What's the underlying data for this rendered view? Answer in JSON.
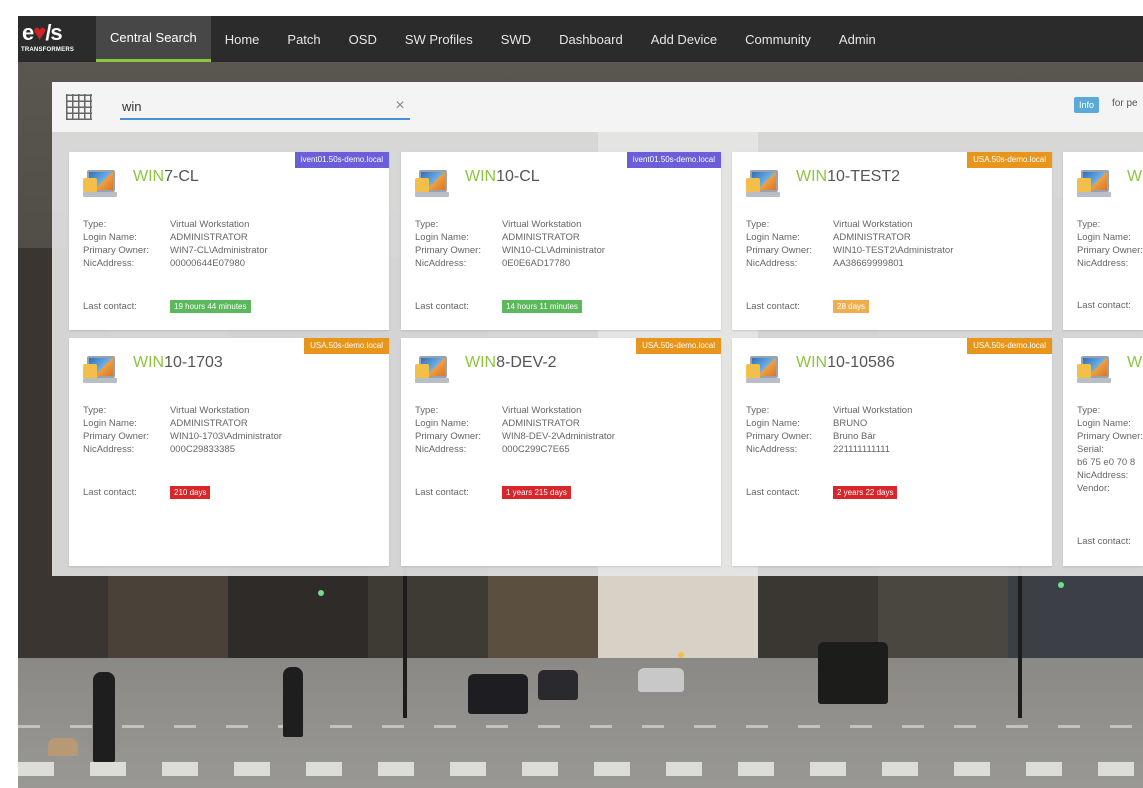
{
  "brand": {
    "logo_text": "e",
    "logo_heart": "♥",
    "logo_suffix": "/s",
    "logo_subtitle": "TRANSFORMERS"
  },
  "nav": {
    "items": [
      {
        "label": "Central Search",
        "active": true
      },
      {
        "label": "Home"
      },
      {
        "label": "Patch"
      },
      {
        "label": "OSD"
      },
      {
        "label": "SW Profiles"
      },
      {
        "label": "SWD"
      },
      {
        "label": "Dashboard"
      },
      {
        "label": "Add Device"
      },
      {
        "label": "Community"
      },
      {
        "label": "Admin"
      }
    ]
  },
  "search": {
    "value": "win",
    "clear_icon": "×",
    "info_badge": "Info",
    "info_text": "for pe"
  },
  "labels": {
    "type": "Type:",
    "login_name": "Login Name:",
    "primary_owner": "Primary Owner:",
    "nic_address": "NicAddress:",
    "serial": "Serial:",
    "vendor": "Vendor:",
    "last_contact": "Last contact:"
  },
  "cards": [
    {
      "name_hl": "WIN",
      "name_rest": "7-CL",
      "domain": "ivent01.50s-demo.local",
      "domain_color": "purple",
      "type": "Virtual Workstation",
      "login_name": "ADMINISTRATOR",
      "primary_owner": "WIN7-CL\\Administrator",
      "nic_address": "00000644E07980",
      "last_contact": "19 hours 44 minutes",
      "contact_color": "green"
    },
    {
      "name_hl": "WIN",
      "name_rest": "10-CL",
      "domain": "ivent01.50s-demo.local",
      "domain_color": "purple",
      "type": "Virtual Workstation",
      "login_name": "ADMINISTRATOR",
      "primary_owner": "WIN10-CL\\Administrator",
      "nic_address": "0E0E6AD17780",
      "last_contact": "14 hours 11 minutes",
      "contact_color": "green"
    },
    {
      "name_hl": "WIN",
      "name_rest": "10-TEST2",
      "domain": "USA.50s-demo.local",
      "domain_color": "orange",
      "type": "Virtual Workstation",
      "login_name": "ADMINISTRATOR",
      "primary_owner": "WIN10-TEST2\\Administrator",
      "nic_address": "AA38669999801",
      "last_contact": "28 days",
      "contact_color": "orange"
    },
    {
      "name_hl": "WI",
      "name_rest": "",
      "domain": "",
      "domain_color": "purple",
      "type_label_only": true,
      "last_contact_label_only": true
    },
    {
      "name_hl": "WIN",
      "name_rest": "10-1703",
      "domain": "USA.50s-demo.local",
      "domain_color": "orange",
      "type": "Virtual Workstation",
      "login_name": "ADMINISTRATOR",
      "primary_owner": "WIN10-1703\\Administrator",
      "nic_address": "000C29833385",
      "last_contact": "210 days",
      "contact_color": "red"
    },
    {
      "name_hl": "WIN",
      "name_rest": "8-DEV-2",
      "domain": "USA.50s-demo.local",
      "domain_color": "orange",
      "type": "Virtual Workstation",
      "login_name": "ADMINISTRATOR",
      "primary_owner": "WIN8-DEV-2\\Administrator",
      "nic_address": "000C299C7E65",
      "last_contact": "1 years 215 days",
      "contact_color": "red"
    },
    {
      "name_hl": "WIN",
      "name_rest": "10-10586",
      "domain": "USA.50s-demo.local",
      "domain_color": "orange",
      "type": "Virtual Workstation",
      "login_name": "BRUNO",
      "primary_owner": "Bruno Bär",
      "nic_address": "221111111111",
      "last_contact": "2 years 22 days",
      "contact_color": "red"
    },
    {
      "name_hl": "WI",
      "name_rest": "",
      "domain": "",
      "domain_color": "orange",
      "serial_value": "b6 75 e0 70 8",
      "last_contact_label_only": true
    }
  ]
}
